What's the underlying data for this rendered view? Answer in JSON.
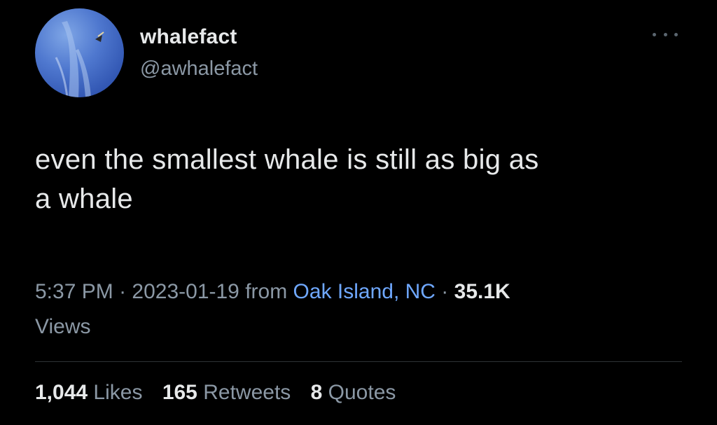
{
  "user": {
    "display_name": "whalefact",
    "handle": "@awhalefact"
  },
  "tweet": {
    "text_line1": "even the smallest whale is still as big as",
    "text_line2": "a whale"
  },
  "meta": {
    "time": "5:37 PM",
    "sep1": " · ",
    "date": "2023-01-19",
    "from": " from ",
    "location": "Oak Island, NC",
    "sep2": " · ",
    "views_count": "35.1K",
    "views_label": "Views"
  },
  "stats": {
    "likes_count": "1,044",
    "likes_label": "Likes",
    "retweets_count": "165",
    "retweets_label": "Retweets",
    "quotes_count": "8",
    "quotes_label": "Quotes"
  },
  "colors": {
    "background": "#000000",
    "primary_text": "#e7e9ea",
    "secondary_text": "#8b98a5",
    "link": "#6fa8ff",
    "divider": "#2f3336"
  },
  "icons": {
    "more": "more-horizontal-icon",
    "avatar": "whale-photo-avatar"
  }
}
